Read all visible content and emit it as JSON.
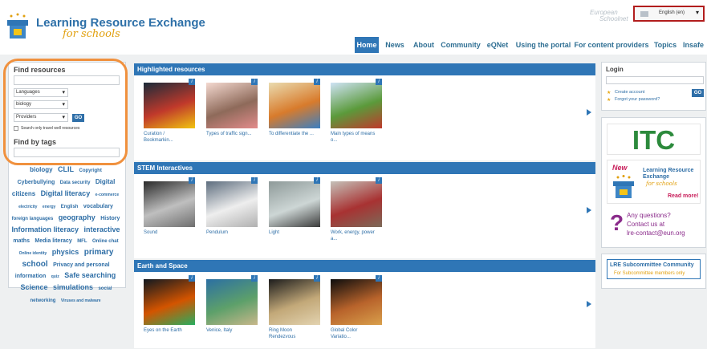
{
  "header": {
    "logo_title": "Learning Resource Exchange",
    "logo_subtitle": "for schools",
    "eun_line1": "European",
    "eun_line2": "Schoolnet",
    "language": "English (en)"
  },
  "nav": {
    "items": [
      "Home",
      "News",
      "About",
      "Community",
      "eQNet",
      "Using the portal",
      "For content providers",
      "Topics",
      "Insafe"
    ],
    "active": "Home"
  },
  "find_resources": {
    "title": "Find resources",
    "search_value": "",
    "languages": "Languages",
    "subject": "biology",
    "providers": "Providers",
    "go": "GO",
    "travel_well": "Search only travel well resources"
  },
  "find_by_tags": {
    "title": "Find by tags",
    "tags": [
      {
        "t": "biology",
        "s": 8
      },
      {
        "t": "CLIL",
        "s": 9
      },
      {
        "t": "Copyright",
        "s": 6
      },
      {
        "t": "Cyberbullying",
        "s": 7
      },
      {
        "t": "Data security",
        "s": 6
      },
      {
        "t": "Digital citizens",
        "s": 8
      },
      {
        "t": "Digital literacy",
        "s": 9
      },
      {
        "t": "e-commerce",
        "s": 5
      },
      {
        "t": "electricity",
        "s": 5
      },
      {
        "t": "energy",
        "s": 5
      },
      {
        "t": "English",
        "s": 6
      },
      {
        "t": "vocabulary",
        "s": 7
      },
      {
        "t": "foreign languages",
        "s": 6
      },
      {
        "t": "geography",
        "s": 9
      },
      {
        "t": "History",
        "s": 7
      },
      {
        "t": "Information literacy",
        "s": 9
      },
      {
        "t": "interactive",
        "s": 9
      },
      {
        "t": "maths",
        "s": 7
      },
      {
        "t": "Media literacy",
        "s": 7
      },
      {
        "t": "MFL",
        "s": 6
      },
      {
        "t": "Online chat",
        "s": 6
      },
      {
        "t": "Online identity",
        "s": 5
      },
      {
        "t": "physics",
        "s": 9
      },
      {
        "t": "primary school",
        "s": 10
      },
      {
        "t": "Privacy and personal information",
        "s": 7
      },
      {
        "t": "quiz",
        "s": 5
      },
      {
        "t": "Safe searching",
        "s": 9
      },
      {
        "t": "Science",
        "s": 9
      },
      {
        "t": "simulations",
        "s": 9
      },
      {
        "t": "social networking",
        "s": 6
      },
      {
        "t": "Viruses and malware",
        "s": 5
      }
    ]
  },
  "sections": [
    {
      "title": "Highlighted resources",
      "items": [
        {
          "l1": "Curation /",
          "l2": "Bookmarkin..."
        },
        {
          "l1": "Types of traffic sign...",
          "l2": ""
        },
        {
          "l1": "To differentiate the ...",
          "l2": ""
        },
        {
          "l1": "Main types of means",
          "l2": "o..."
        }
      ]
    },
    {
      "title": "STEM Interactives",
      "items": [
        {
          "l1": "Sound",
          "l2": ""
        },
        {
          "l1": "Pendulum",
          "l2": ""
        },
        {
          "l1": "Light",
          "l2": ""
        },
        {
          "l1": "Work, energy, power",
          "l2": "a..."
        }
      ]
    },
    {
      "title": "Earth and Space",
      "items": [
        {
          "l1": "Eyes on the Earth",
          "l2": ""
        },
        {
          "l1": "Venice, Italy",
          "l2": ""
        },
        {
          "l1": "Ring Moon",
          "l2": "Rendezvous"
        },
        {
          "l1": "Global Color",
          "l2": "Variatio..."
        }
      ]
    }
  ],
  "login": {
    "title": "Login",
    "create_account": "Create account",
    "forgot_password": "Forgot your password?",
    "go": "GO"
  },
  "itc": {
    "text": "ITC"
  },
  "promo": {
    "new": "New",
    "line1": "Learning Resource",
    "line2": "Exchange",
    "line3": "for schools",
    "more": "Read more!"
  },
  "questions": {
    "line1": "Any questions?",
    "line2": "Contact us at",
    "line3": "lre-contact@eun.org"
  },
  "subcommittee": {
    "title": "LRE Subcommittee Community",
    "subtitle": "For Subcommittee members only"
  },
  "colors": {
    "accent": "#2f76b6",
    "highlight_ring": "#f0913e",
    "lang_border": "#b21d1d"
  }
}
